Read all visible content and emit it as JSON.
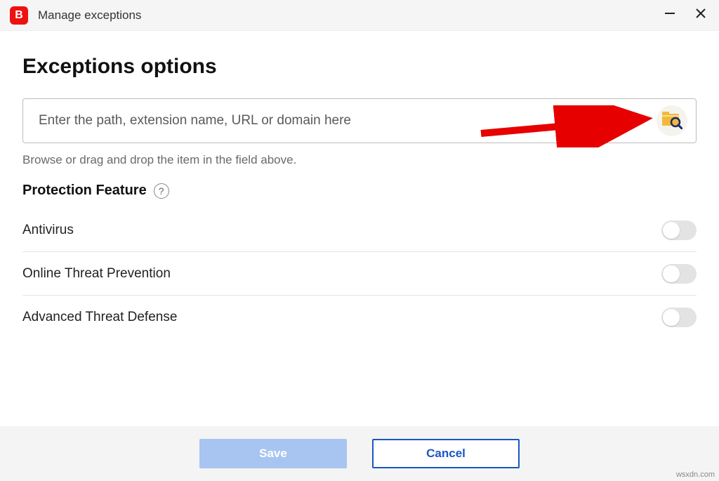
{
  "titlebar": {
    "app_letter": "B",
    "title": "Manage exceptions"
  },
  "page": {
    "heading": "Exceptions options",
    "input_placeholder": "Enter the path, extension name, URL or domain here",
    "hint": "Browse or drag and drop the item in the field above.",
    "section_title": "Protection Feature"
  },
  "features": [
    {
      "label": "Antivirus",
      "enabled": false
    },
    {
      "label": "Online Threat Prevention",
      "enabled": false
    },
    {
      "label": "Advanced Threat Defense",
      "enabled": false
    }
  ],
  "footer": {
    "save": "Save",
    "cancel": "Cancel"
  },
  "source": "wsxdn.com"
}
